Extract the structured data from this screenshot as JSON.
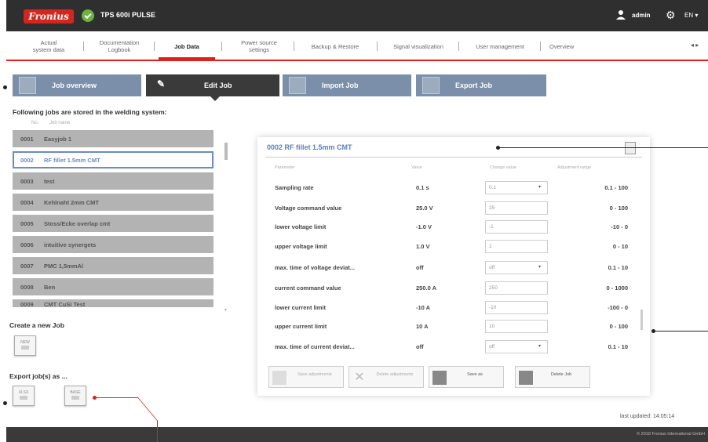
{
  "header": {
    "logo": "Fronius",
    "device": "TPS 600i PULSE",
    "user": "admin",
    "language": "EN ▾"
  },
  "nav": {
    "items": [
      {
        "label": "Actual\nsystem data"
      },
      {
        "label": "Documentation\nLogbook"
      },
      {
        "label": "Job Data"
      },
      {
        "label": "Power source\nsettings"
      },
      {
        "label": "Backup & Restore"
      },
      {
        "label": "Signal visualization"
      },
      {
        "label": "User management"
      },
      {
        "label": "Overview"
      }
    ],
    "arrows": "◂ ▸"
  },
  "tabs": [
    {
      "label": "Job overview"
    },
    {
      "label": "Edit Job"
    },
    {
      "label": "Import Job"
    },
    {
      "label": "Export Job"
    }
  ],
  "stored_title": "Following jobs are stored in the welding system:",
  "job_list": {
    "header_no": "No.",
    "header_name": "Job name",
    "jobs": [
      {
        "num": "0001",
        "name": "Easyjob 1"
      },
      {
        "num": "0002",
        "name": "RF fillet 1.5mm CMT"
      },
      {
        "num": "0003",
        "name": "test"
      },
      {
        "num": "0004",
        "name": "Kehlnaht 2mm CMT"
      },
      {
        "num": "0005",
        "name": "Stoss/Ecke overlap cmt"
      },
      {
        "num": "0006",
        "name": "intuitive synergets"
      },
      {
        "num": "0007",
        "name": "PMC 1,5mmAl"
      },
      {
        "num": "0008",
        "name": "Ben"
      },
      {
        "num": "0009",
        "name": "CMT CuSi Test"
      }
    ]
  },
  "create_title": "Create a new Job",
  "create_btn": "NEW",
  "export_title": "Export job(s) as ...",
  "export_btns": [
    "XLSX",
    "BASE"
  ],
  "panel": {
    "title": "0002 RF fillet 1.5mm CMT",
    "col_param": "Parameter",
    "col_value": "Value",
    "col_change": "Change value",
    "col_range": "Adjustment range",
    "rows": [
      {
        "name": "Sampling rate",
        "value": "0.1 s",
        "input": "0.1",
        "dropdown": true,
        "range": "0.1 - 100"
      },
      {
        "name": "Voltage command value",
        "value": "25.0 V",
        "input": "25",
        "dropdown": false,
        "range": "0 - 100"
      },
      {
        "name": "lower voltage limit",
        "value": "-1.0 V",
        "input": "-1",
        "dropdown": false,
        "range": "-10 - 0"
      },
      {
        "name": "upper voltage limit",
        "value": "1.0 V",
        "input": "1",
        "dropdown": false,
        "range": "0 - 10"
      },
      {
        "name": "max. time of voltage deviat...",
        "value": "off",
        "input": "off",
        "dropdown": true,
        "range": "0.1 - 10"
      },
      {
        "name": "current command value",
        "value": "250.0 A",
        "input": "250",
        "dropdown": false,
        "range": "0 - 1000"
      },
      {
        "name": "lower current limit",
        "value": "-10 A",
        "input": "-10",
        "dropdown": false,
        "range": "-100 - 0"
      },
      {
        "name": "upper current limit",
        "value": "10 A",
        "input": "10",
        "dropdown": false,
        "range": "0 - 100"
      },
      {
        "name": "max. time of current deviat...",
        "value": "off",
        "input": "off",
        "dropdown": true,
        "range": "0.1 - 10"
      }
    ],
    "buttons": [
      {
        "label": "Save adjustments"
      },
      {
        "label": "Delete adjustments"
      },
      {
        "label": "Save as"
      },
      {
        "label": "Delete Job"
      }
    ]
  },
  "last_updated": "last updated: 14:05:14",
  "copyright": "© 2018 Fronius International GmbH"
}
